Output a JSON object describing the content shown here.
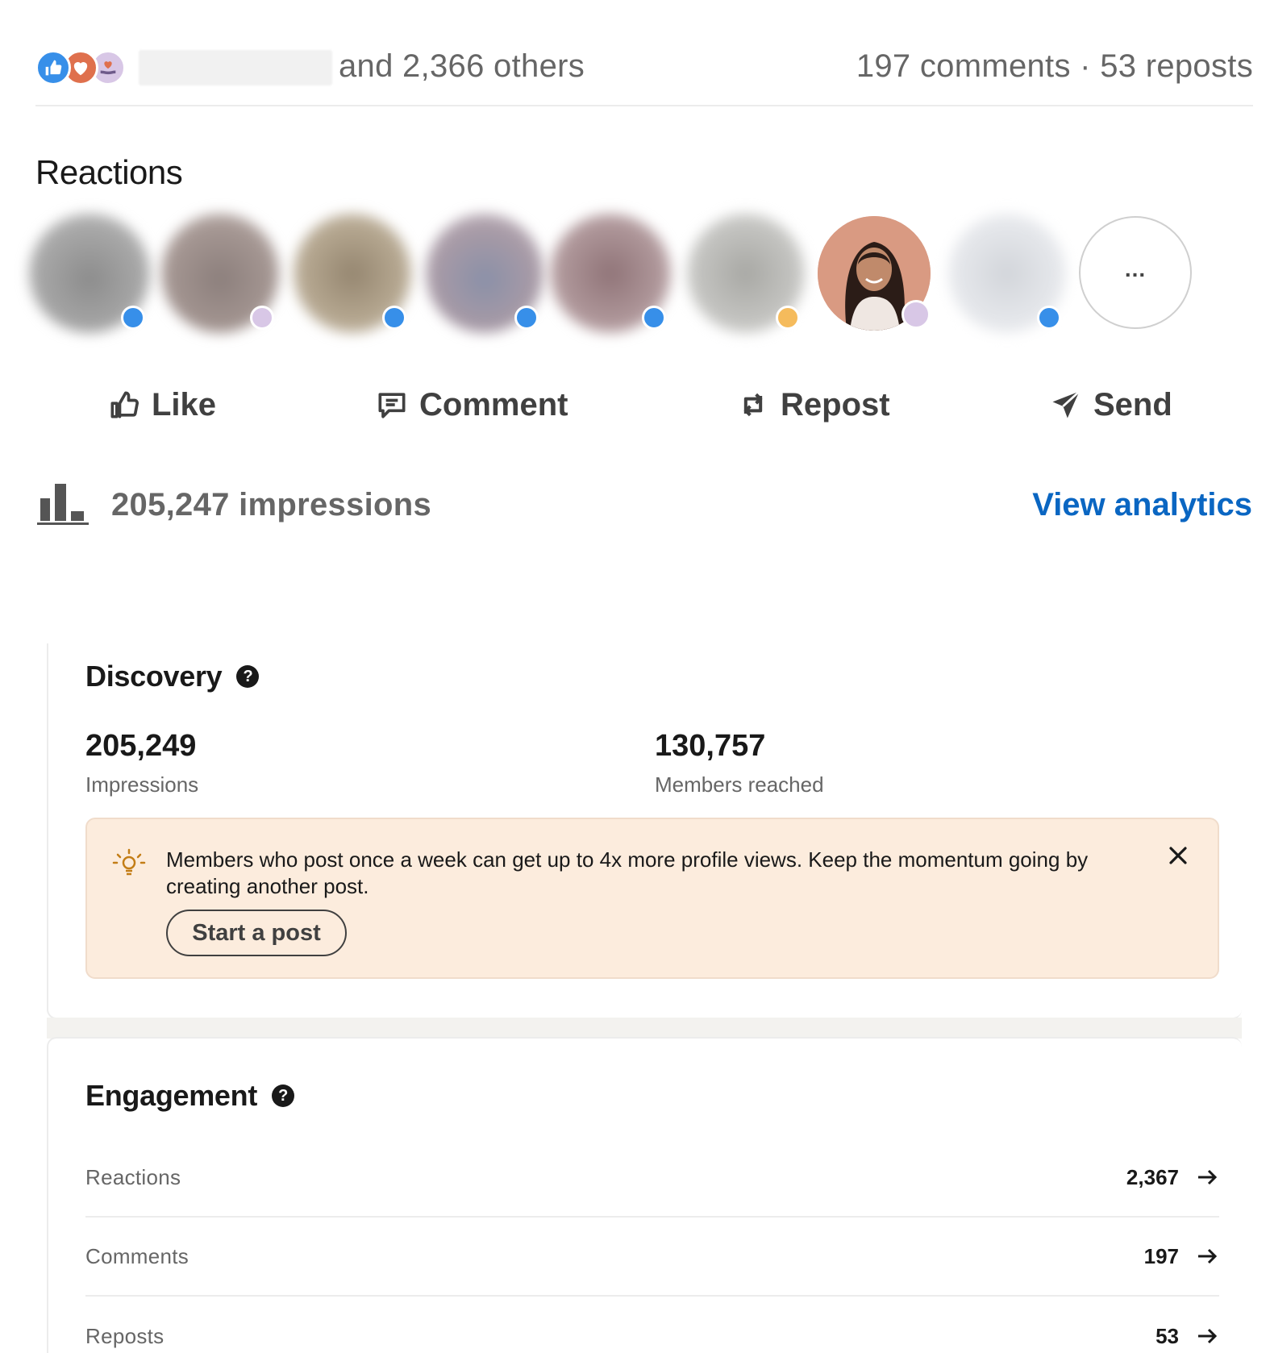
{
  "social": {
    "others_text": "and 2,366 others",
    "counts_text": "197 comments · 53 reposts"
  },
  "reactions": {
    "heading": "Reactions",
    "more_label": "..."
  },
  "actions": {
    "like": "Like",
    "comment": "Comment",
    "repost": "Repost",
    "send": "Send"
  },
  "impressions": {
    "text": "205,247 impressions",
    "view_analytics": "View analytics"
  },
  "discovery": {
    "title": "Discovery",
    "impressions_value": "205,249",
    "impressions_label": "Impressions",
    "members_value": "130,757",
    "members_label": "Members reached",
    "tip_text": "Members who post once a week can get up to 4x more profile views. Keep the momentum going by creating another post.",
    "tip_button": "Start a post"
  },
  "engagement": {
    "title": "Engagement",
    "rows": [
      {
        "label": "Reactions",
        "value": "2,367"
      },
      {
        "label": "Comments",
        "value": "197"
      },
      {
        "label": "Reposts",
        "value": "53"
      }
    ]
  },
  "colors": {
    "accent_blue": "#0a66c2",
    "like_blue": "#378fe9",
    "love_red": "#df704d",
    "support_purple": "#d8c7e6",
    "tip_background": "#fcecdd"
  }
}
